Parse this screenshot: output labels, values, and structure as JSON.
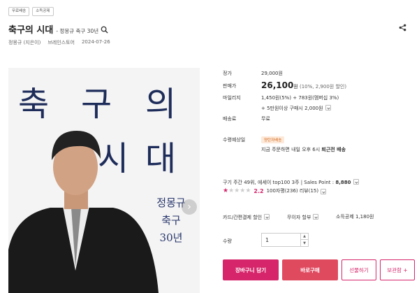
{
  "badges": [
    "무료배송",
    "소득공제"
  ],
  "product": {
    "title": "축구의 시대",
    "subtitle": "- 정몽규 축구 30년",
    "author": "정몽규 (지은이)",
    "publisher": "브레인스토어",
    "date": "2024-07-26"
  },
  "cover": {
    "big_chars": [
      "축",
      "구",
      "의",
      "시",
      "대"
    ],
    "small_lines": [
      "정몽규",
      "축구",
      "30년"
    ],
    "colors": {
      "text": "#1e2c5a",
      "bg": "#f4f4f4"
    }
  },
  "info": {
    "list_price_label": "정가",
    "list_price": "29,000원",
    "sale_price_label": "판매가",
    "sale_price": "26,100",
    "sale_unit": "원",
    "sale_note": "(10%, 2,900원 할인)",
    "mileage_label": "마일리지",
    "mileage_line1": "1,450원(5%) + 783원(멤버십 3%)",
    "mileage_line2": "+ 5만원이상 구매시 2,000원",
    "shipping_label": "배송료",
    "shipping": "무료",
    "delivery_label": "수령예상일",
    "delivery_tag": "양탄자배송",
    "delivery_text": "지금 주문하면 내일 오후 6시 ",
    "delivery_bold": "퇴근전 배송",
    "rank_text": "구기 주간 49위, 에세이 top100 3주  |  Sales Point : ",
    "sales_point": "8,880",
    "rating": "2.2",
    "rating_value": 2.2,
    "review_text": "100자평(236)  리뷰(15)",
    "card_discount": "카드/간편결제 할인",
    "installment": "무이자 할부",
    "deduction": "소득공제 1,180원",
    "qty_label": "수량",
    "qty_value": "1"
  },
  "buttons": {
    "cart": "장바구니 담기",
    "buy": "바로구매",
    "gift": "선물하기",
    "keep": "보관함 +"
  },
  "colors": {
    "accent": "#d6256a",
    "buy": "#e04a5f"
  }
}
